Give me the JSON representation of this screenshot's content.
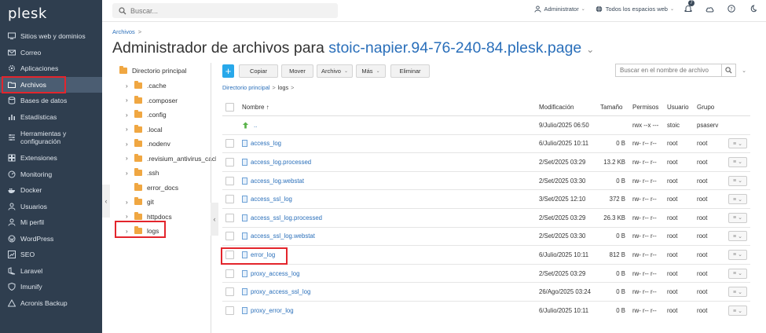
{
  "sidebar": {
    "logo": "plesk",
    "items": [
      {
        "label": "Sitios web y dominios",
        "icon": "monitor-icon"
      },
      {
        "label": "Correo",
        "icon": "mail-icon"
      },
      {
        "label": "Aplicaciones",
        "icon": "gear-icon"
      },
      {
        "label": "Archivos",
        "icon": "folder-icon",
        "active": true
      },
      {
        "label": "Bases de datos",
        "icon": "database-icon"
      },
      {
        "label": "Estadísticas",
        "icon": "chart-icon"
      },
      {
        "label": "Herramientas y configuración",
        "icon": "tools-icon"
      },
      {
        "label": "Extensiones",
        "icon": "puzzle-icon"
      },
      {
        "label": "Monitoring",
        "icon": "monitoring-icon"
      },
      {
        "label": "Docker",
        "icon": "docker-icon"
      },
      {
        "label": "Usuarios",
        "icon": "user-icon"
      },
      {
        "label": "Mi perfil",
        "icon": "profile-icon"
      },
      {
        "label": "WordPress",
        "icon": "wordpress-icon"
      },
      {
        "label": "SEO",
        "icon": "seo-icon"
      },
      {
        "label": "Laravel",
        "icon": "laravel-icon"
      },
      {
        "label": "Imunify",
        "icon": "shield-icon"
      },
      {
        "label": "Acronis Backup",
        "icon": "backup-icon"
      }
    ]
  },
  "topbar": {
    "search_placeholder": "Buscar...",
    "user": "Administrator",
    "scope": "Todos los espacios web",
    "notifications_count": "7"
  },
  "breadcrumb": {
    "item": "Archivos",
    "sep": ">"
  },
  "title": {
    "prefix": "Administrador de archivos para ",
    "domain": "stoic-napier.94-76-240-84.plesk.page"
  },
  "tree": {
    "root": "Directorio principal",
    "folders": [
      {
        "name": ".cache",
        "expandable": true
      },
      {
        "name": ".composer",
        "expandable": true
      },
      {
        "name": ".config",
        "expandable": true
      },
      {
        "name": ".local",
        "expandable": true
      },
      {
        "name": ".nodenv",
        "expandable": true
      },
      {
        "name": ".revisium_antivirus_cach",
        "expandable": true
      },
      {
        "name": ".ssh",
        "expandable": true
      },
      {
        "name": "error_docs",
        "expandable": false
      },
      {
        "name": "git",
        "expandable": true
      },
      {
        "name": "httpdocs",
        "expandable": true
      },
      {
        "name": "logs",
        "expandable": true,
        "selected": true
      }
    ]
  },
  "toolbar": {
    "add": "+",
    "copy": "Copiar",
    "move": "Mover",
    "file": "Archivo",
    "more": "Más",
    "delete": "Eliminar",
    "search_placeholder": "Buscar en el nombre de archivo"
  },
  "path": {
    "root": "Directorio principal",
    "sep": ">",
    "current": "logs"
  },
  "table": {
    "headers": {
      "name": "Nombre ↑",
      "modified": "Modificación",
      "size": "Tamaño",
      "perms": "Permisos",
      "user": "Usuario",
      "group": "Grupo"
    },
    "parent": {
      "name": "..",
      "modified": "9/Julio/2025 06:50",
      "size": "",
      "perms": "rwx --x ---",
      "user": "stoic",
      "group": "psaserv"
    },
    "rows": [
      {
        "name": "access_log",
        "modified": "6/Julio/2025 10:11",
        "size": "0 B",
        "perms": "rw- r-- r--",
        "user": "root",
        "group": "root"
      },
      {
        "name": "access_log.processed",
        "modified": "2/Set/2025 03:29",
        "size": "13.2 KB",
        "perms": "rw- r-- r--",
        "user": "root",
        "group": "root"
      },
      {
        "name": "access_log.webstat",
        "modified": "2/Set/2025 03:30",
        "size": "0 B",
        "perms": "rw- r-- r--",
        "user": "root",
        "group": "root"
      },
      {
        "name": "access_ssl_log",
        "modified": "3/Set/2025 12:10",
        "size": "372 B",
        "perms": "rw- r-- r--",
        "user": "root",
        "group": "root"
      },
      {
        "name": "access_ssl_log.processed",
        "modified": "2/Set/2025 03:29",
        "size": "26.3 KB",
        "perms": "rw- r-- r--",
        "user": "root",
        "group": "root"
      },
      {
        "name": "access_ssl_log.webstat",
        "modified": "2/Set/2025 03:30",
        "size": "0 B",
        "perms": "rw- r-- r--",
        "user": "root",
        "group": "root"
      },
      {
        "name": "error_log",
        "modified": "6/Julio/2025 10:11",
        "size": "812 B",
        "perms": "rw- r-- r--",
        "user": "root",
        "group": "root"
      },
      {
        "name": "proxy_access_log",
        "modified": "2/Set/2025 03:29",
        "size": "0 B",
        "perms": "rw- r-- r--",
        "user": "root",
        "group": "root"
      },
      {
        "name": "proxy_access_ssl_log",
        "modified": "26/Ago/2025 03:24",
        "size": "0 B",
        "perms": "rw- r-- r--",
        "user": "root",
        "group": "root"
      },
      {
        "name": "proxy_error_log",
        "modified": "6/Julio/2025 10:11",
        "size": "0 B",
        "perms": "rw- r-- r--",
        "user": "root",
        "group": "root"
      }
    ]
  },
  "colors": {
    "sidebar": "#2f3e4f",
    "active": "#4b5d72",
    "link": "#2a6fba",
    "accent": "#28a8ea",
    "highlight": "#e3252c",
    "folder": "#f0a742"
  }
}
